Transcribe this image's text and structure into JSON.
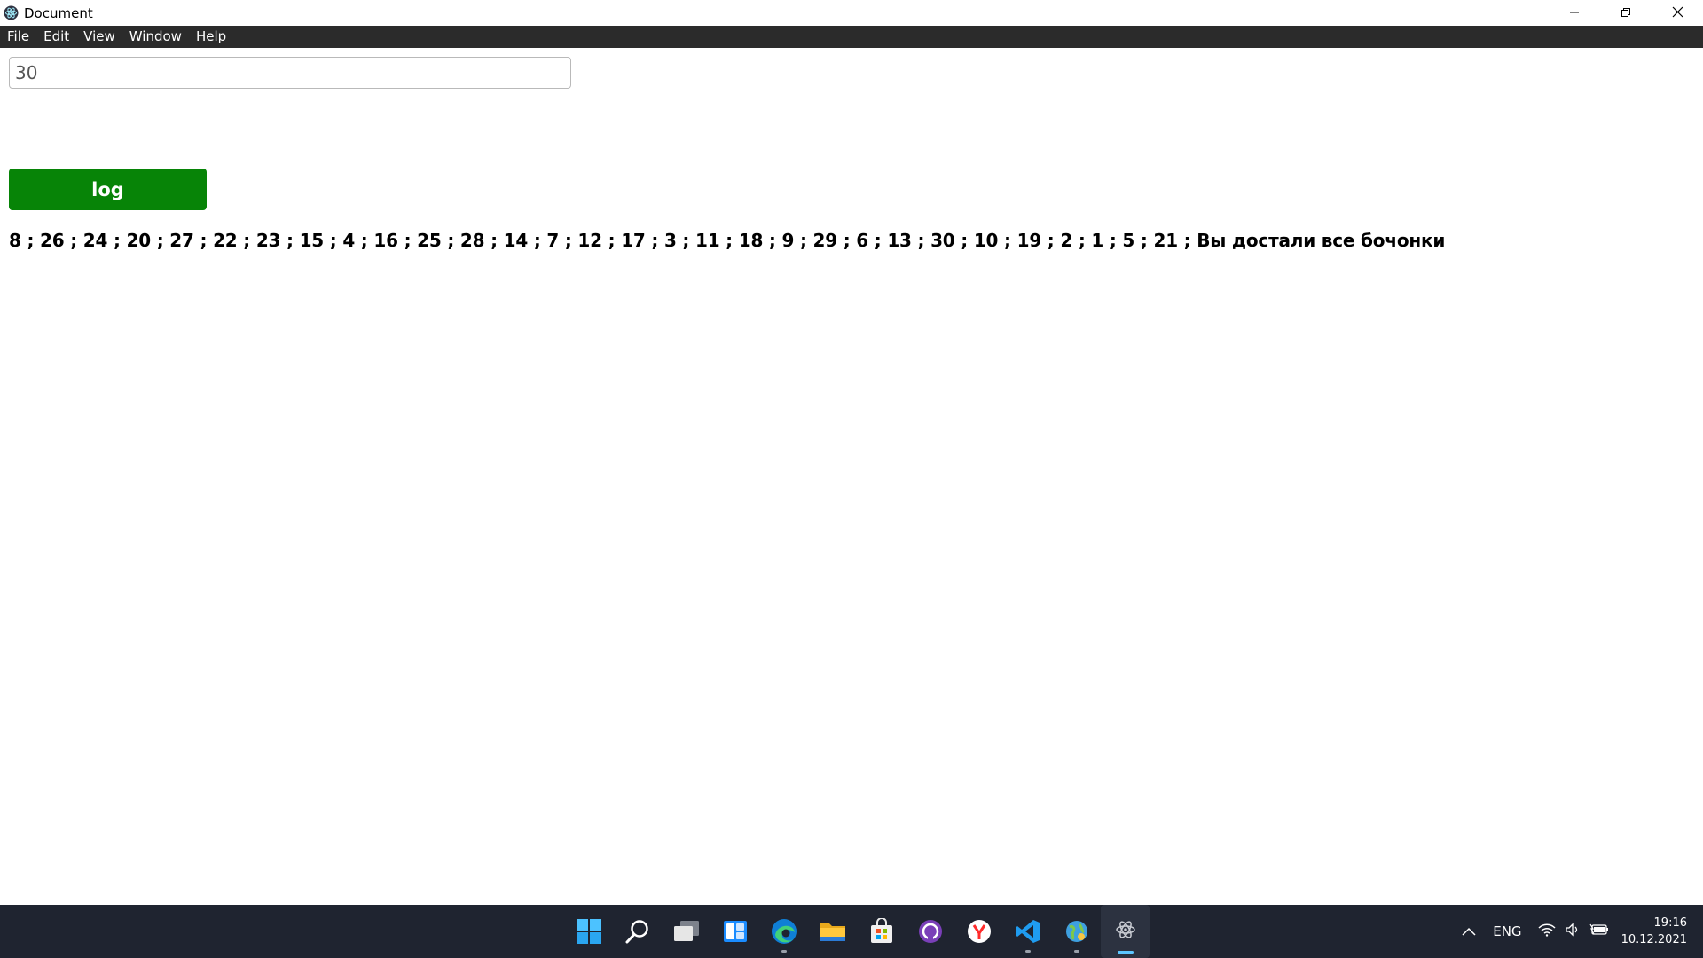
{
  "window": {
    "title": "Document",
    "controls": {
      "minimize_icon": "minimize-icon",
      "restore_icon": "restore-icon",
      "close_icon": "close-icon"
    }
  },
  "menu": {
    "items": [
      "File",
      "Edit",
      "View",
      "Window",
      "Help"
    ]
  },
  "form": {
    "input_value": "30",
    "button_label": "log",
    "button_color": "#078407"
  },
  "output": {
    "text": "8 ; 26 ; 24 ; 20 ; 27 ; 22 ; 23 ; 15 ; 4 ; 16 ; 25 ; 28 ; 14 ; 7 ; 12 ; 17 ; 3 ; 11 ; 18 ; 9 ; 29 ; 6 ; 13 ; 30 ; 10 ; 19 ; 2 ; 1 ; 5 ; 21 ; Вы достали все бочонки"
  },
  "taskbar": {
    "apps": [
      "windows-start-icon",
      "search-icon",
      "task-view-icon",
      "widgets-icon",
      "edge-browser-icon",
      "file-explorer-icon",
      "microsoft-store-icon",
      "github-desktop-icon",
      "yandex-browser-icon",
      "vscode-icon",
      "nodejs-globe-icon",
      "electron-app-icon"
    ],
    "tray": {
      "language": "ENG",
      "time": "19:16",
      "date": "10.12.2021"
    }
  }
}
